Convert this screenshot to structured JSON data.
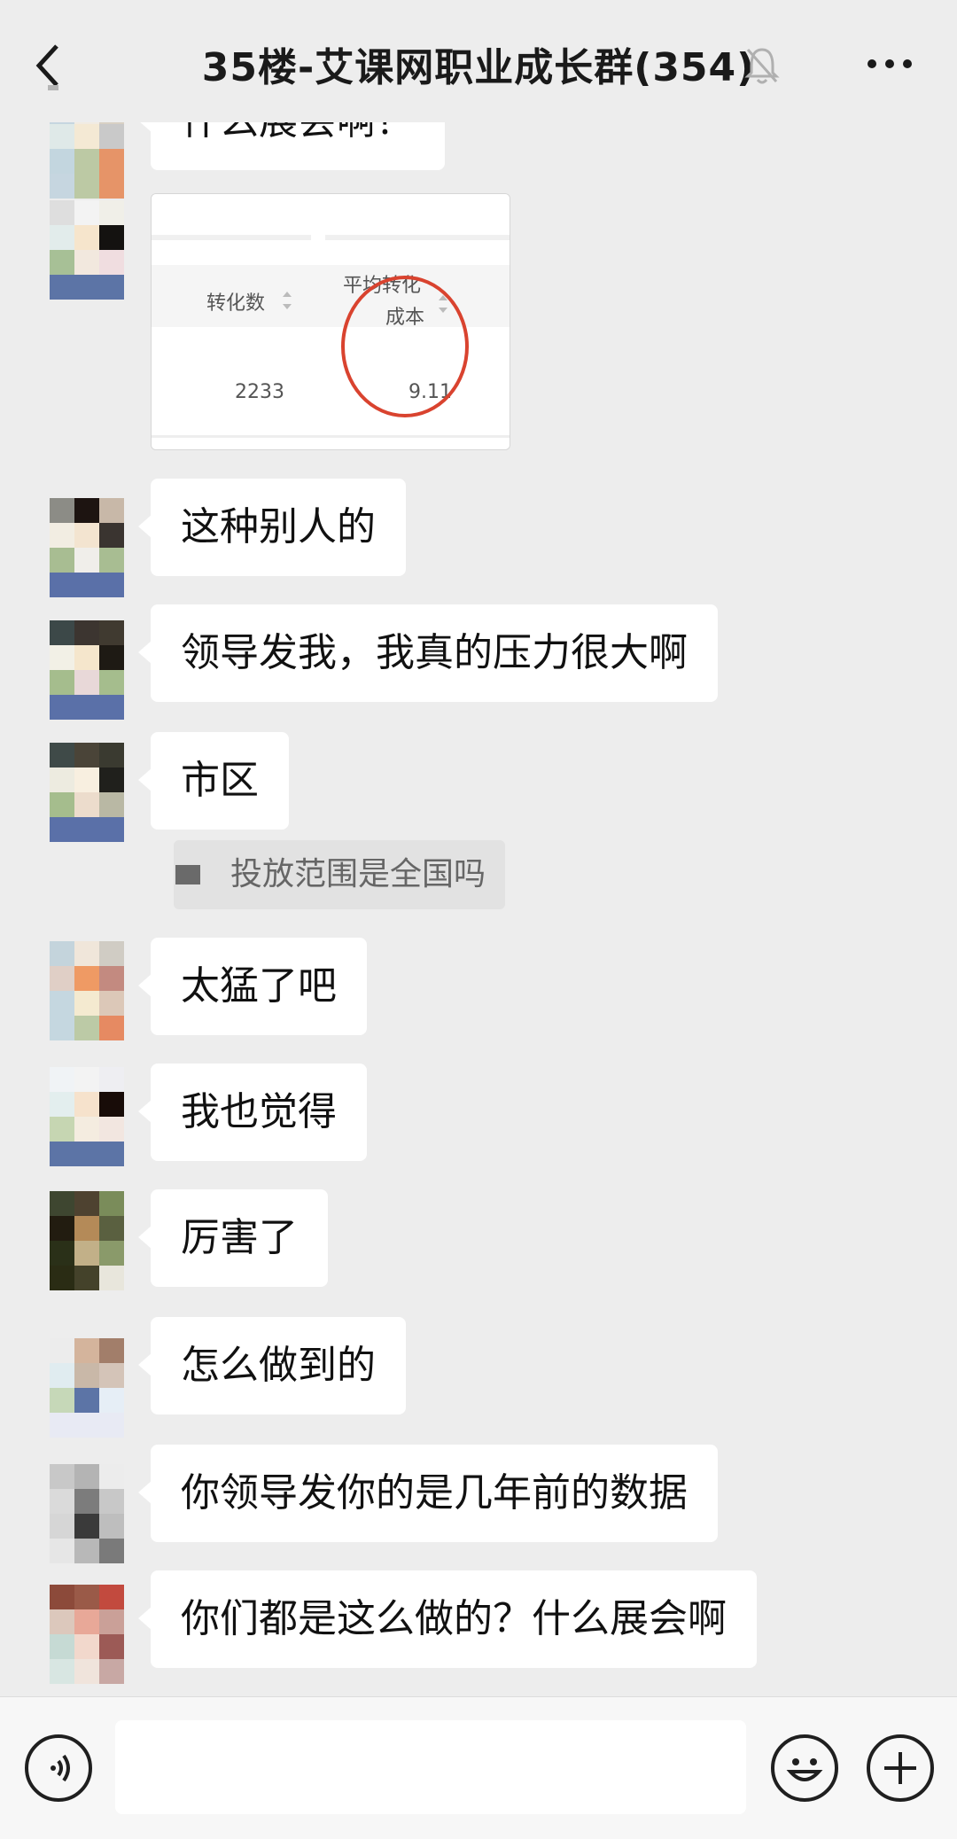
{
  "header": {
    "title": "35楼-艾课网职业成长群(354)"
  },
  "image_message": {
    "col1": "转化数",
    "col2_line1": "平均转化",
    "col2_line2": "成本",
    "val1": "2233",
    "val2": "9.11"
  },
  "messages": [
    {
      "text": "什么展会啊？"
    },
    {
      "text": "这种别人的"
    },
    {
      "text": "领导发我，我真的压力很大啊"
    },
    {
      "text": "市区"
    },
    {
      "text": "太猛了吧"
    },
    {
      "text": "我也觉得"
    },
    {
      "text": "厉害了"
    },
    {
      "text": "怎么做到的"
    },
    {
      "text": "你领导发你的是几年前的数据"
    },
    {
      "text": "你们都是这么做的？什么展会啊"
    }
  ],
  "quote": {
    "text": "投放范围是全国吗"
  },
  "input": {
    "value": ""
  },
  "colors": {
    "background": "#ededed",
    "bubble": "#ffffff",
    "highlight_circle": "#d9432f"
  }
}
